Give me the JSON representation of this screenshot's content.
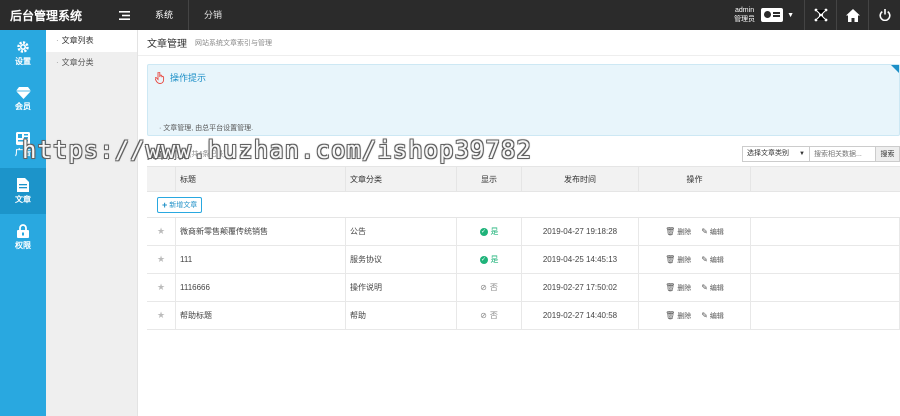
{
  "topbar": {
    "brand": "后台管理系统",
    "nav": [
      "系统",
      "分销"
    ],
    "admin_name": "admin",
    "admin_role": "管理员"
  },
  "leftbar": {
    "items": [
      {
        "label": "设置",
        "icon": "gear-icon"
      },
      {
        "label": "会员",
        "icon": "diamond-icon"
      },
      {
        "label": "广告",
        "icon": "ad-icon"
      },
      {
        "label": "文章",
        "icon": "document-icon"
      },
      {
        "label": "权限",
        "icon": "lock-icon"
      }
    ]
  },
  "submenu": {
    "items": [
      "文章列表",
      "文章分类"
    ]
  },
  "page": {
    "title": "文章管理",
    "subtitle": "网站系统文章索引与管理"
  },
  "tips": {
    "title": "操作提示",
    "line": "文章管理, 由总平台设置管理."
  },
  "list": {
    "title": "文章列表",
    "count": "(共4条记录)",
    "category_select": "选择文章类别",
    "search_placeholder": "搜索相关数据...",
    "search_button": "搜索",
    "add_button": "新增文章"
  },
  "table": {
    "headers": {
      "title": "标题",
      "category": "文章分类",
      "show": "显示",
      "time": "发布时间",
      "op": "操作"
    },
    "delete_label": "删除",
    "edit_label": "编辑",
    "rows": [
      {
        "title": "微商新零售颠覆传统销售",
        "category": "公告",
        "show": "是",
        "time": "2019-04-27 19:18:28"
      },
      {
        "title": "111",
        "category": "服务协议",
        "show": "是",
        "time": "2019-04-25 14:45:13"
      },
      {
        "title": "1116666",
        "category": "操作说明",
        "show": "否",
        "time": "2019-02-27 17:50:02"
      },
      {
        "title": "帮助标题",
        "category": "帮助",
        "show": "否",
        "time": "2019-02-27 14:40:58"
      }
    ]
  },
  "watermark": "https://www.huzhan.com/ishop39782",
  "colors": {
    "topbar": "#2b2b2b",
    "sidebar": "#29a8e0",
    "accent": "#1c8fc7",
    "yes": "#1fb37a"
  }
}
